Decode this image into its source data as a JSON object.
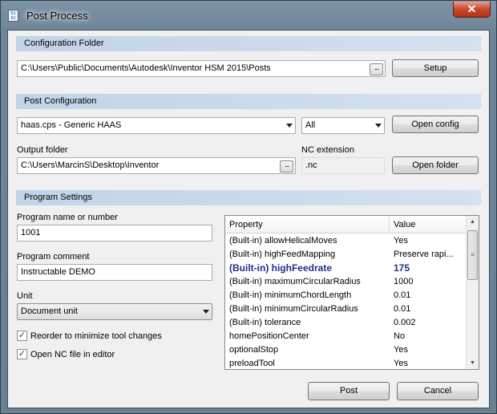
{
  "window": {
    "title": "Post Process",
    "icon_text": "01 02",
    "close_glyph": "✕"
  },
  "configuration_folder": {
    "header": "Configuration Folder",
    "path": "C:\\Users\\Public\\Documents\\Autodesk\\Inventor HSM 2015\\Posts",
    "browse_label": "...",
    "setup_label": "Setup"
  },
  "post_configuration": {
    "header": "Post Configuration",
    "post_select": "haas.cps - Generic HAAS",
    "filter_select": "All",
    "open_config_label": "Open config",
    "output_folder_label": "Output folder",
    "output_folder": "C:\\Users\\MarcinS\\Desktop\\Inventor",
    "browse_label": "...",
    "nc_extension_label": "NC extension",
    "nc_extension": ".nc",
    "open_folder_label": "Open folder"
  },
  "program_settings": {
    "header": "Program Settings",
    "program_name_label": "Program name or number",
    "program_name": "1001",
    "program_comment_label": "Program comment",
    "program_comment": "Instructable DEMO",
    "unit_label": "Unit",
    "unit": "Document unit",
    "reorder_label": "Reorder to minimize tool changes",
    "reorder_checked": true,
    "open_nc_label": "Open NC file in editor",
    "open_nc_checked": true,
    "check_glyph": "✓"
  },
  "properties": {
    "columns": [
      "Property",
      "Value"
    ],
    "rows": [
      {
        "property": "(Built-in) allowHelicalMoves",
        "value": "Yes",
        "bold": false
      },
      {
        "property": "(Built-in) highFeedMapping",
        "value": "Preserve rapi...",
        "bold": false
      },
      {
        "property": "(Built-in) highFeedrate",
        "value": "175",
        "bold": true
      },
      {
        "property": "(Built-in) maximumCircularRadius",
        "value": "1000",
        "bold": false
      },
      {
        "property": "(Built-in) minimumChordLength",
        "value": "0.01",
        "bold": false
      },
      {
        "property": "(Built-in) minimumCircularRadius",
        "value": "0.01",
        "bold": false
      },
      {
        "property": "(Built-in) tolerance",
        "value": "0.002",
        "bold": false
      },
      {
        "property": "homePositionCenter",
        "value": "No",
        "bold": false
      },
      {
        "property": "optionalStop",
        "value": "Yes",
        "bold": false
      },
      {
        "property": "preloadTool",
        "value": "Yes",
        "bold": false
      }
    ],
    "scroll_up": "▲",
    "scroll_down": "▼",
    "scroll_grip": "≡"
  },
  "actions": {
    "post_label": "Post",
    "cancel_label": "Cancel"
  }
}
